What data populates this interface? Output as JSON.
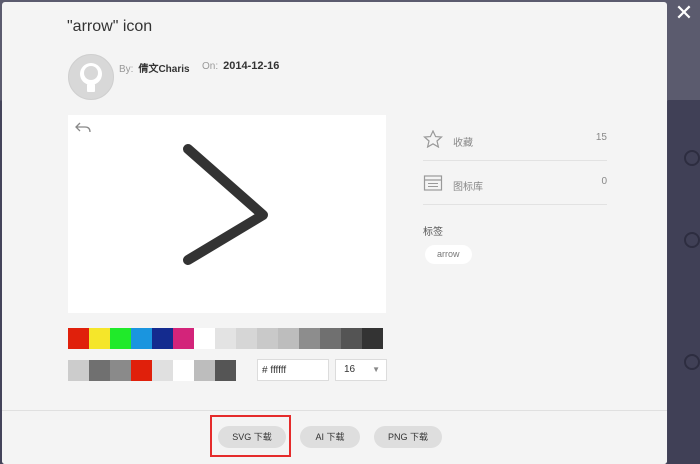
{
  "dialog": {
    "title": "\"arrow\" icon",
    "close_label": "✕"
  },
  "meta": {
    "author_label": "By:",
    "author_name": "倩文Charis",
    "date_label": "On:",
    "date_value": "2014-12-16"
  },
  "colors": {
    "row1": [
      "#e0200b",
      "#f5e62a",
      "#20ea2a",
      "#1a95df",
      "#142b8f",
      "#d3247a",
      "#ffffff",
      "#e3e3e3",
      "#d6d6d6",
      "#c9c9c9",
      "#bdbdbd",
      "#8d8d8d",
      "#707070",
      "#545454",
      "#333333"
    ],
    "row2": [
      "#cccccc",
      "#707070",
      "#8a8a8a",
      "#e0200b",
      "#e0e0e0",
      "#ffffff",
      "#bdbdbd",
      "#555555"
    ],
    "icon_stroke": "#333333",
    "highlight": "#e52b2b"
  },
  "editor": {
    "hex_value": "# ffffff",
    "size_value": "16"
  },
  "stats": {
    "favorites_label": "收藏",
    "favorites_count": "15",
    "library_label": "图标库",
    "library_count": "0"
  },
  "tags": {
    "title": "标签",
    "items": [
      "arrow"
    ]
  },
  "downloads": {
    "svg_label": "SVG 下载",
    "ai_label": "AI 下载",
    "png_label": "PNG 下载"
  }
}
